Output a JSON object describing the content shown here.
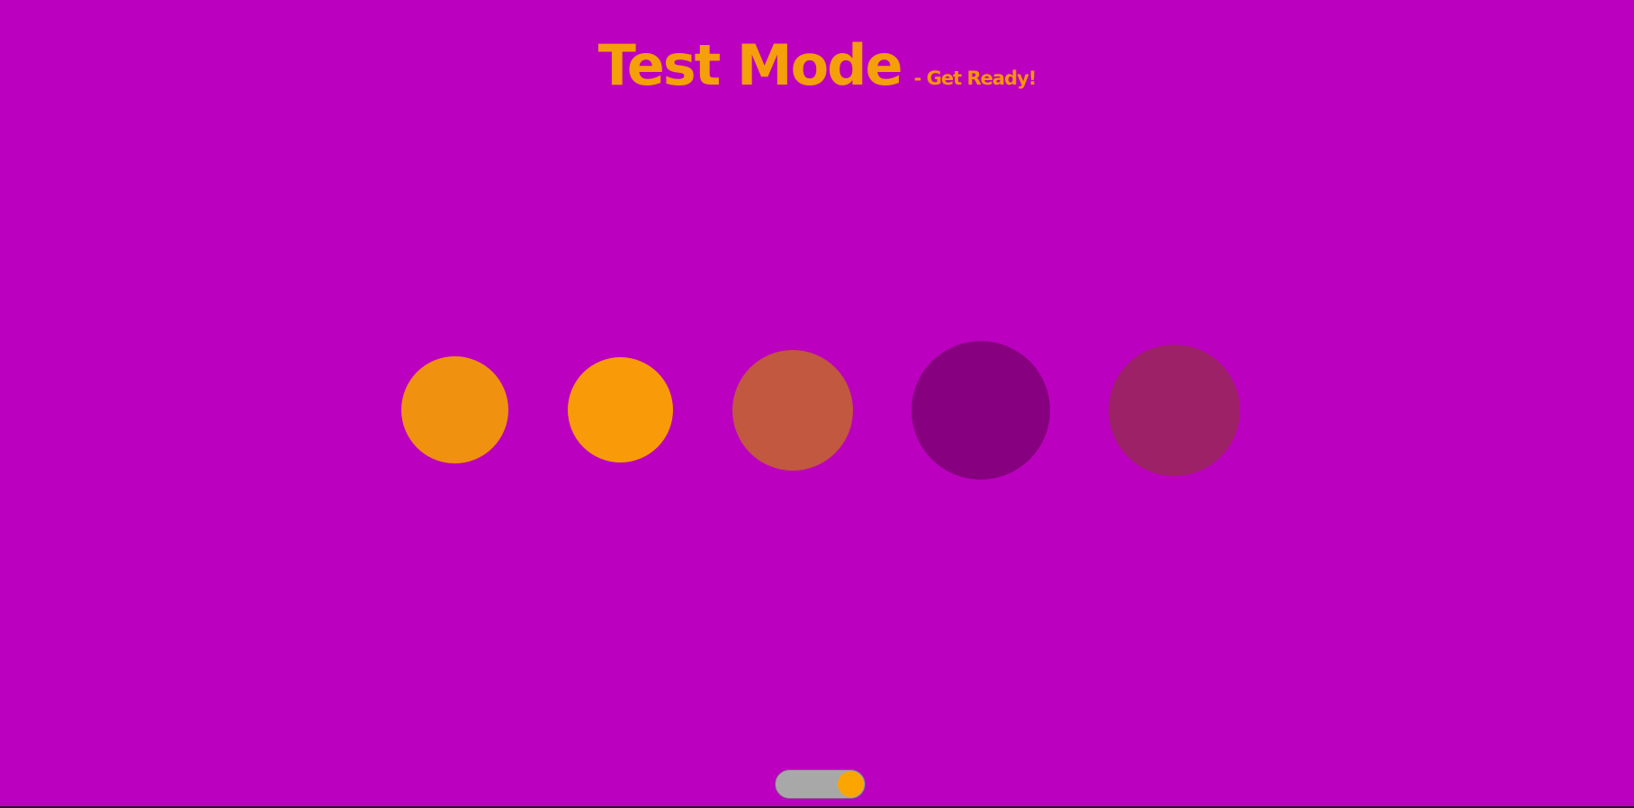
{
  "header": {
    "title": "Test Mode",
    "subtitle": "- Get Ready!"
  },
  "colors": {
    "background": "#bc00bf",
    "title": "#f59f0a",
    "subtitle": "#f5950a",
    "toggle_track": "#a8a8a8",
    "toggle_knob": "#fba500"
  },
  "circles": [
    {
      "color": "#f19110"
    },
    {
      "color": "#f99b09"
    },
    {
      "color": "#c2583f"
    },
    {
      "color": "#86007f"
    },
    {
      "color": "#9d2166"
    }
  ],
  "toggle": {
    "state": "on"
  }
}
